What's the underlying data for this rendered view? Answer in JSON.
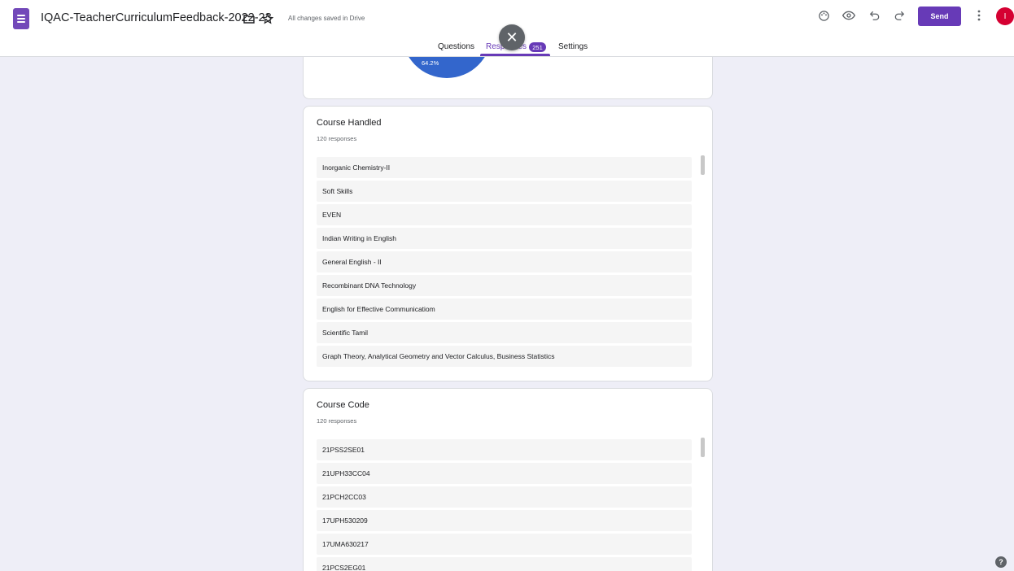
{
  "header": {
    "doc_title": "IQAC-TeacherCurriculumFeedback-2022-23",
    "saved_status": "All changes saved in Drive",
    "send_label": "Send",
    "avatar_letter": "I"
  },
  "tabs": {
    "questions": "Questions",
    "responses": "Responses",
    "settings": "Settings",
    "responses_count": "251"
  },
  "pie_card": {
    "slice_label": "64.2%"
  },
  "course_handled": {
    "title": "Course Handled",
    "subtitle": "120 responses",
    "items": [
      "Inorganic Chemistry-II",
      "Soft Skills",
      "EVEN",
      "Indian Writing in English",
      "General English - II",
      "Recombinant DNA Technology",
      "English for Effective Communicatiom",
      "Scientific Tamil",
      "Graph Theory, Analytical Geometry and Vector Calculus, Business Statistics"
    ]
  },
  "course_code": {
    "title": "Course Code",
    "subtitle": "120 responses",
    "items": [
      "21PSS2SE01",
      "21UPH33CC04",
      "21PCH2CC03",
      "17UPH530209",
      "17UMA630217",
      "21PCS2EG01"
    ]
  },
  "colors": {
    "accent": "#673ab7",
    "pie_blue": "#3366cc",
    "avatar": "#d50032"
  }
}
